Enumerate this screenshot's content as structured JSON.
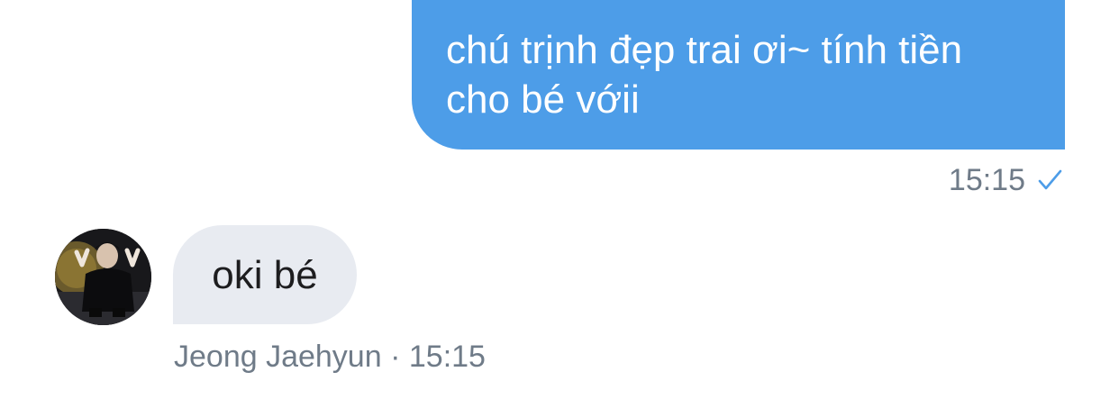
{
  "colors": {
    "outgoing_bubble": "#4d9de8",
    "incoming_bubble": "#e8ebf1",
    "meta_text": "#6f7b88",
    "check_mark": "#4d9de8"
  },
  "messages": [
    {
      "direction": "outgoing",
      "text": "chú trịnh đẹp trai ơi~ tính tiền cho bé vớii",
      "time": "15:15",
      "status_icon": "check-icon"
    },
    {
      "direction": "incoming",
      "text": "oki bé",
      "sender": "Jeong Jaehyun",
      "separator": "·",
      "time": "15:15",
      "avatar_icon": "avatar-photo"
    }
  ]
}
